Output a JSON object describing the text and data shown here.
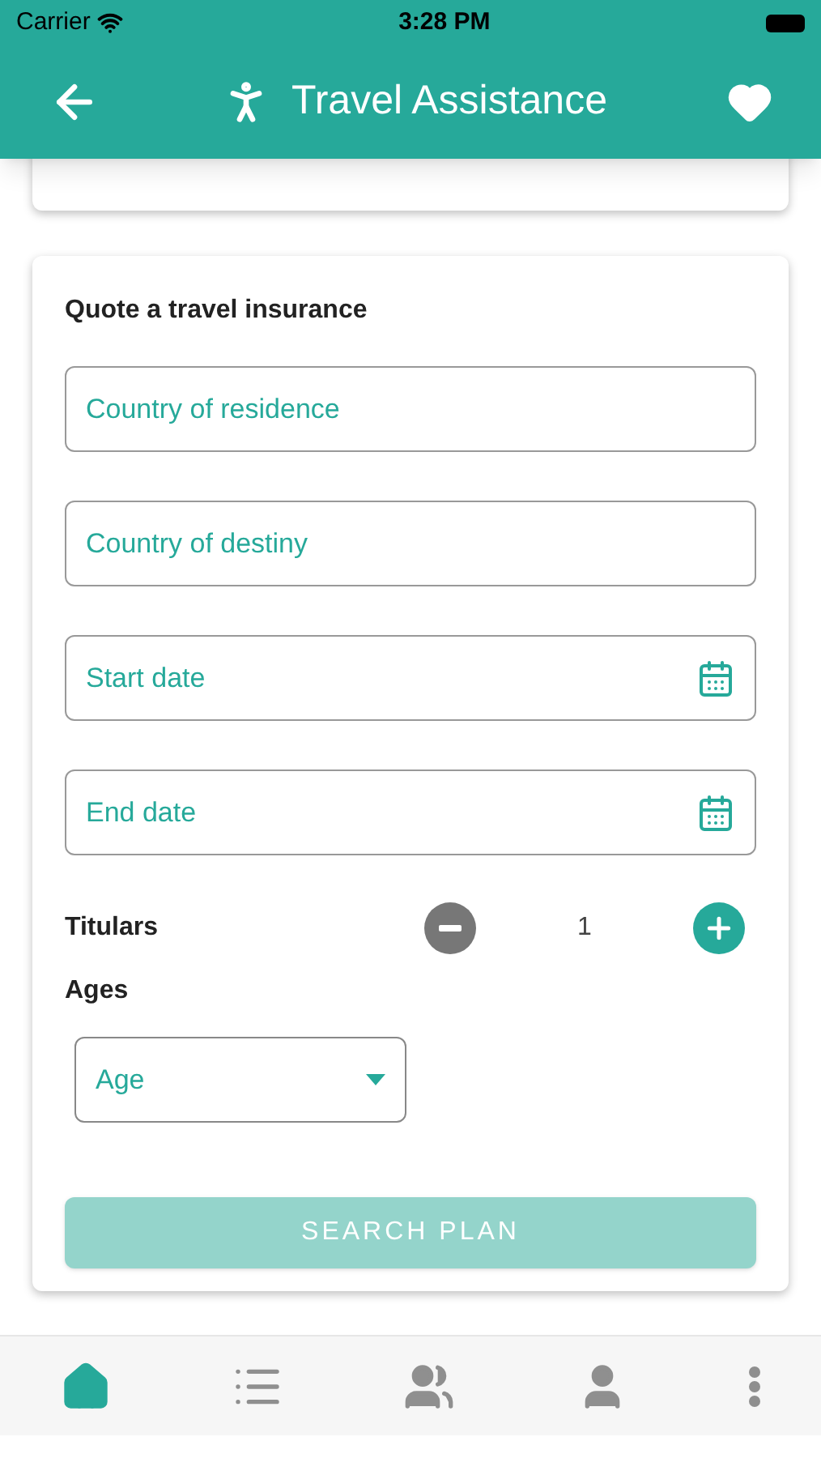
{
  "status_bar": {
    "carrier": "Carrier",
    "time": "3:28 PM"
  },
  "header": {
    "title": "Travel Assistance",
    "favorite": true
  },
  "quote_form": {
    "title": "Quote a travel insurance",
    "fields": [
      {
        "placeholder": "Country of residence",
        "kind": "text"
      },
      {
        "placeholder": "Country of destiny",
        "kind": "text"
      },
      {
        "placeholder": "Start date",
        "kind": "date"
      },
      {
        "placeholder": "End date",
        "kind": "date"
      }
    ],
    "titulars": {
      "label": "Titulars",
      "value": "1",
      "decrement_disabled": true
    },
    "ages": {
      "label": "Ages",
      "select_placeholder": "Age"
    },
    "search_button": {
      "label": "SEARCH PLAN",
      "disabled": true
    }
  },
  "bottom_nav": [
    {
      "kind": "home",
      "selected": true
    },
    {
      "kind": "list",
      "selected": false
    },
    {
      "kind": "group",
      "selected": false
    },
    {
      "kind": "profile",
      "selected": false
    },
    {
      "kind": "more",
      "selected": false
    }
  ]
}
